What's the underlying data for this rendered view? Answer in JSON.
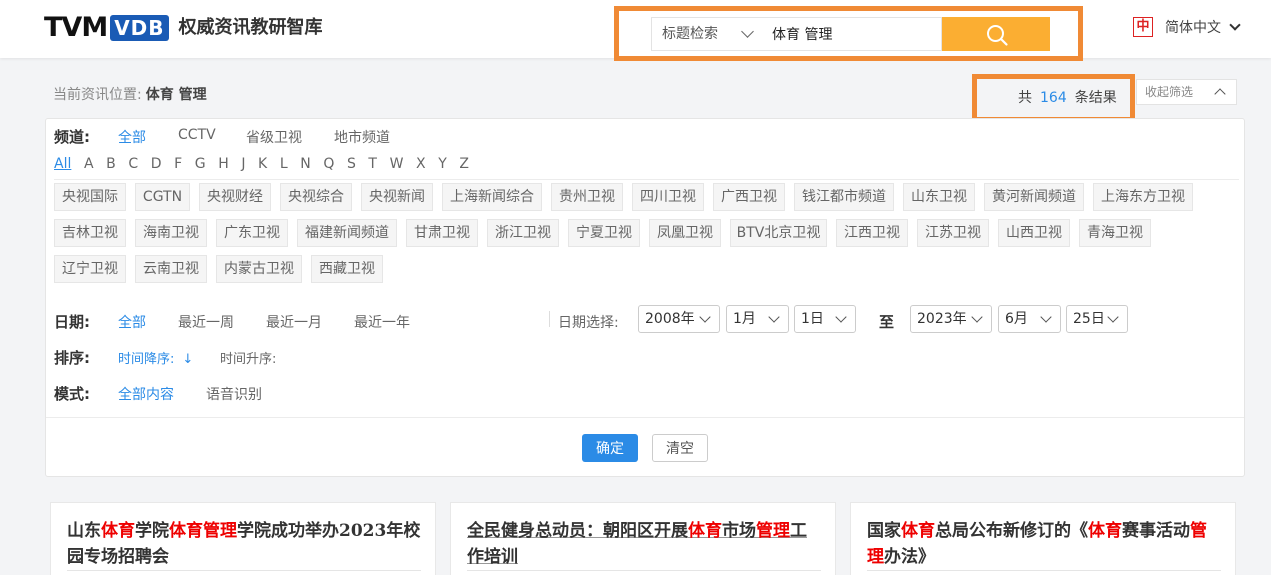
{
  "header": {
    "logo_tvm": "TVM",
    "logo_vdb": "VDB",
    "site_name": "权威资讯教研智库",
    "search": {
      "type_label": "标题检索",
      "query": "体育 管理",
      "button_icon": "search-icon"
    },
    "language": {
      "icon": "中",
      "label": "简体中文"
    }
  },
  "location": {
    "prefix": "当前资讯位置:",
    "value": "体育 管理"
  },
  "results": {
    "prefix": "共",
    "count": "164",
    "suffix": "条结果"
  },
  "collapse_label": "收起筛选",
  "filters": {
    "channel": {
      "label": "频道:",
      "options": [
        "全部",
        "CCTV",
        "省级卫视",
        "地市频道"
      ],
      "active": "全部"
    },
    "letters": [
      "All",
      "A",
      "B",
      "C",
      "D",
      "F",
      "G",
      "H",
      "J",
      "K",
      "L",
      "N",
      "Q",
      "S",
      "T",
      "W",
      "X",
      "Y",
      "Z"
    ],
    "channel_tags": [
      "央视国际",
      "CGTN",
      "央视财经",
      "央视综合",
      "央视新闻",
      "上海新闻综合",
      "贵州卫视",
      "四川卫视",
      "广西卫视",
      "钱江都市频道",
      "山东卫视",
      "黄河新闻频道",
      "上海东方卫视",
      "吉林卫视",
      "海南卫视",
      "广东卫视",
      "福建新闻频道",
      "甘肃卫视",
      "浙江卫视",
      "宁夏卫视",
      "凤凰卫视",
      "BTV北京卫视",
      "江西卫视",
      "江苏卫视",
      "山西卫视",
      "青海卫视",
      "辽宁卫视",
      "云南卫视",
      "内蒙古卫视",
      "西藏卫视"
    ],
    "date": {
      "label": "日期:",
      "options": [
        "全部",
        "最近一周",
        "最近一月",
        "最近一年"
      ],
      "active": "全部",
      "picker_label": "日期选择:",
      "from": {
        "year": "2008年",
        "month": "1月",
        "day": "1日"
      },
      "to_label": "至",
      "to": {
        "year": "2023年",
        "month": "6月",
        "day": "25日"
      }
    },
    "sort": {
      "label": "排序:",
      "desc": "时间降序:",
      "desc_arrow": "↓",
      "asc": "时间升序:"
    },
    "mode": {
      "label": "模式:",
      "options": [
        "全部内容",
        "语音识别"
      ],
      "active": "全部内容"
    },
    "confirm_label": "确定",
    "clear_label": "清空"
  },
  "cards": [
    {
      "title_parts": [
        "山东",
        "体育",
        "学院",
        "体育管理",
        "学院成功举办2023年校园专场招聘会"
      ]
    },
    {
      "title_parts": [
        "全民健身总动员：朝阳区开展",
        "体育",
        "市场",
        "管理",
        "工作培训"
      ]
    },
    {
      "title_parts": [
        "国家",
        "体育",
        "总局公布新修订的《",
        "体育",
        "赛事活动",
        "管理",
        "办法》"
      ]
    }
  ],
  "colors": {
    "accent_blue": "#2b8be6",
    "highlight_red": "#e00000",
    "search_button": "#fbae32",
    "annotation_orange": "#f08a35"
  }
}
